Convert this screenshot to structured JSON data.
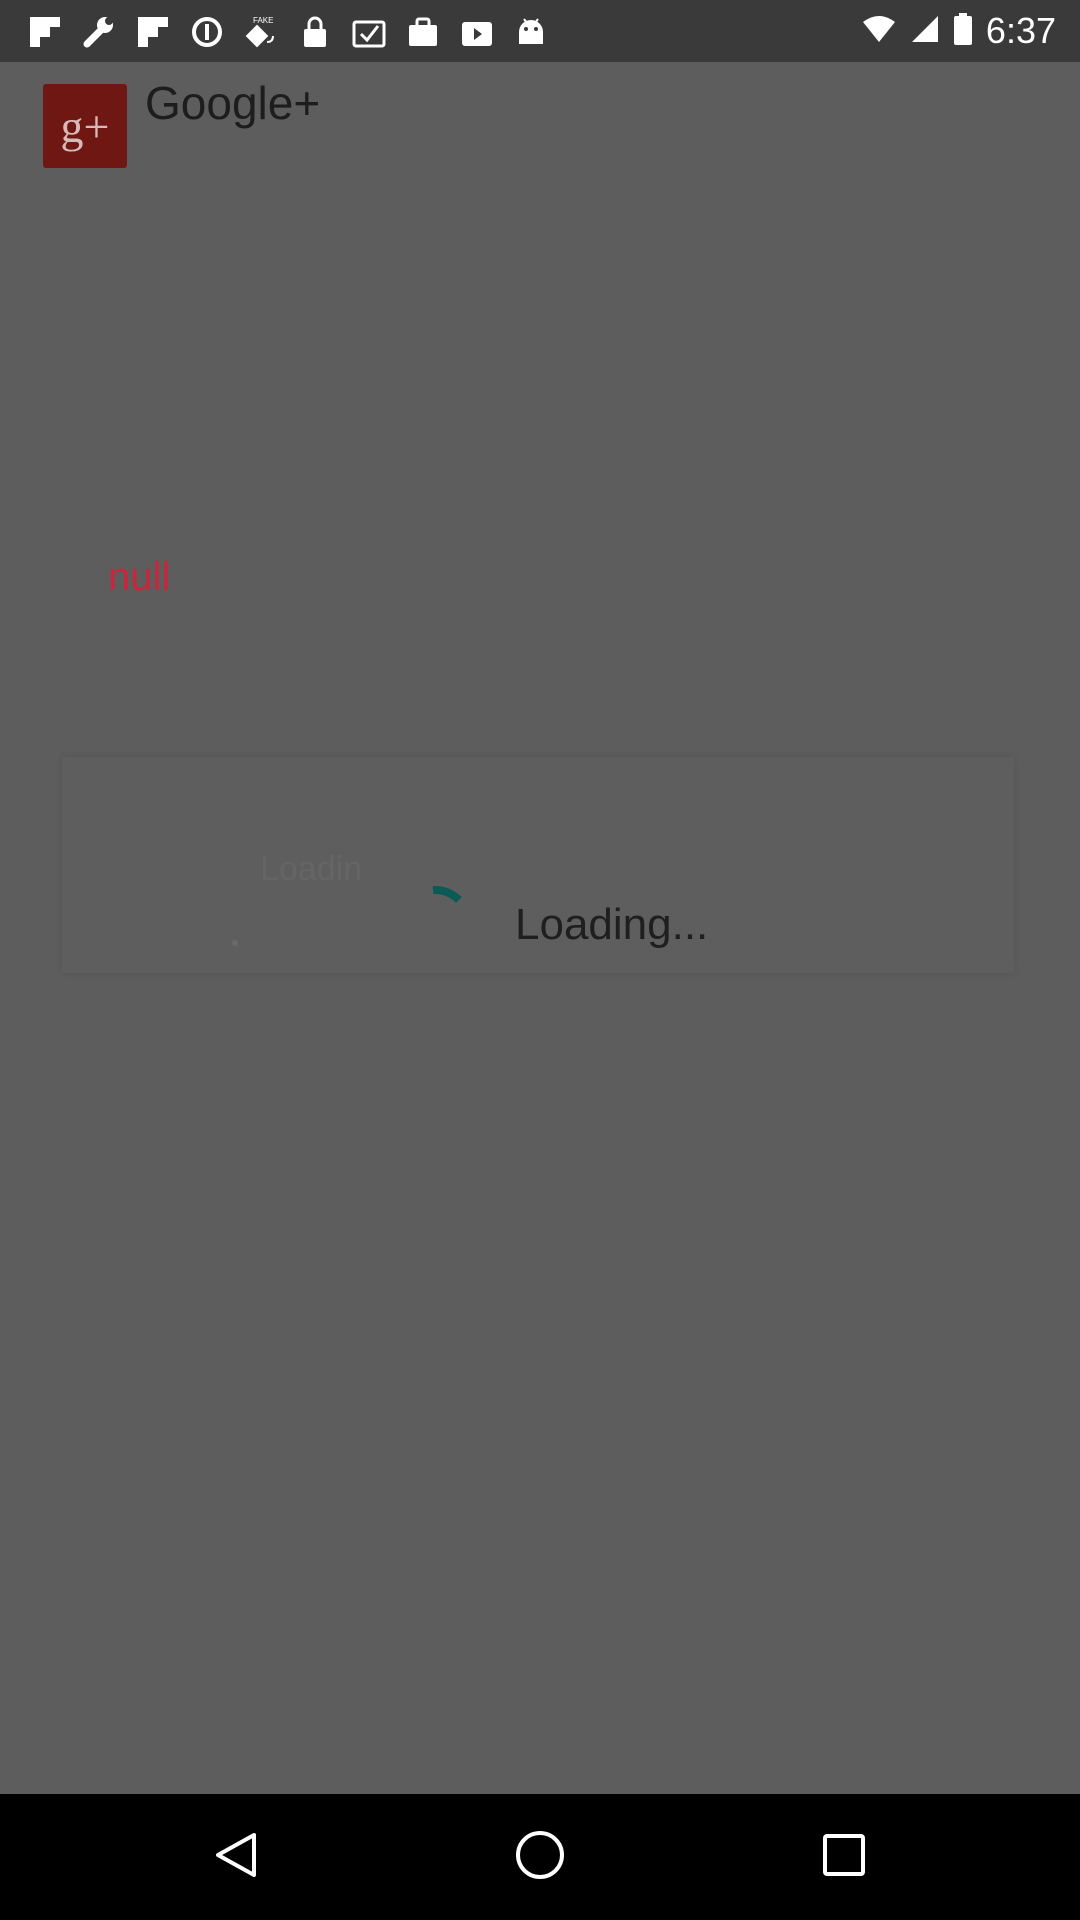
{
  "status_bar": {
    "time": "6:37",
    "icons": [
      "flipboard-icon",
      "wrench-icon",
      "flipboard-icon",
      "data-saver-icon",
      "fake-gps-icon",
      "lock-icon",
      "clipboard-check-icon",
      "bag-icon",
      "play-store-icon",
      "android-icon"
    ],
    "right_icons": [
      "wifi-icon",
      "signal-icon",
      "battery-icon"
    ]
  },
  "app": {
    "logo_text": "g+",
    "title": "Google+",
    "null_label": "null",
    "ghost_loading": "Loadin",
    "loading_label": "Loading..."
  },
  "colors": {
    "overlay_bg": "#5d5d5d",
    "logo_bg": "#6f1712",
    "null_text": "#c8263d",
    "spinner": "#0b5a56"
  },
  "nav": {
    "buttons": [
      "back-icon",
      "home-icon",
      "recents-icon"
    ]
  }
}
